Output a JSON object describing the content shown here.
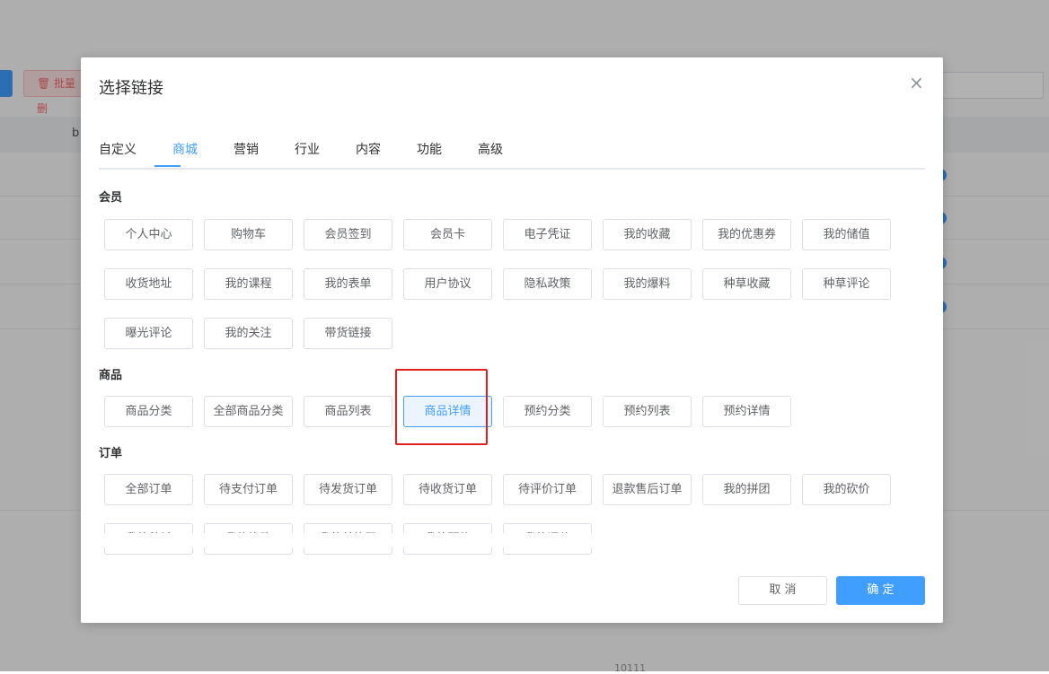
{
  "background": {
    "delete_label": "🗑 批量删",
    "column_fragment": "b",
    "bottom_fragment": "10111"
  },
  "dialog": {
    "title": "选择链接",
    "close_icon": "×",
    "tabs": [
      "自定义",
      "商城",
      "营销",
      "行业",
      "内容",
      "功能",
      "高级"
    ],
    "active_tab": "商城",
    "sections": {
      "member": {
        "title": "会员",
        "items": [
          "个人中心",
          "购物车",
          "会员签到",
          "会员卡",
          "电子凭证",
          "我的收藏",
          "我的优惠券",
          "我的储值",
          "收货地址",
          "我的课程",
          "我的表单",
          "用户协议",
          "隐私政策",
          "我的爆料",
          "种草收藏",
          "种草评论",
          "曝光评论",
          "我的关注",
          "带货链接"
        ]
      },
      "goods": {
        "title": "商品",
        "items": [
          "商品分类",
          "全部商品分类",
          "商品列表",
          "商品详情",
          "预约分类",
          "预约列表",
          "预约详情"
        ],
        "selected": "商品详情"
      },
      "orders": {
        "title": "订单",
        "items": [
          "全部订单",
          "待支付订单",
          "待发货订单",
          "待收货订单",
          "待评价订单",
          "退款售后订单",
          "我的拼团",
          "我的砍价",
          "我的秒杀",
          "我的换购",
          "我的兑换码",
          "我的预约",
          "我的评价"
        ]
      }
    },
    "cancel_label": "取 消",
    "confirm_label": "确 定"
  },
  "colors": {
    "primary": "#409eff",
    "highlight": "#e02020"
  }
}
